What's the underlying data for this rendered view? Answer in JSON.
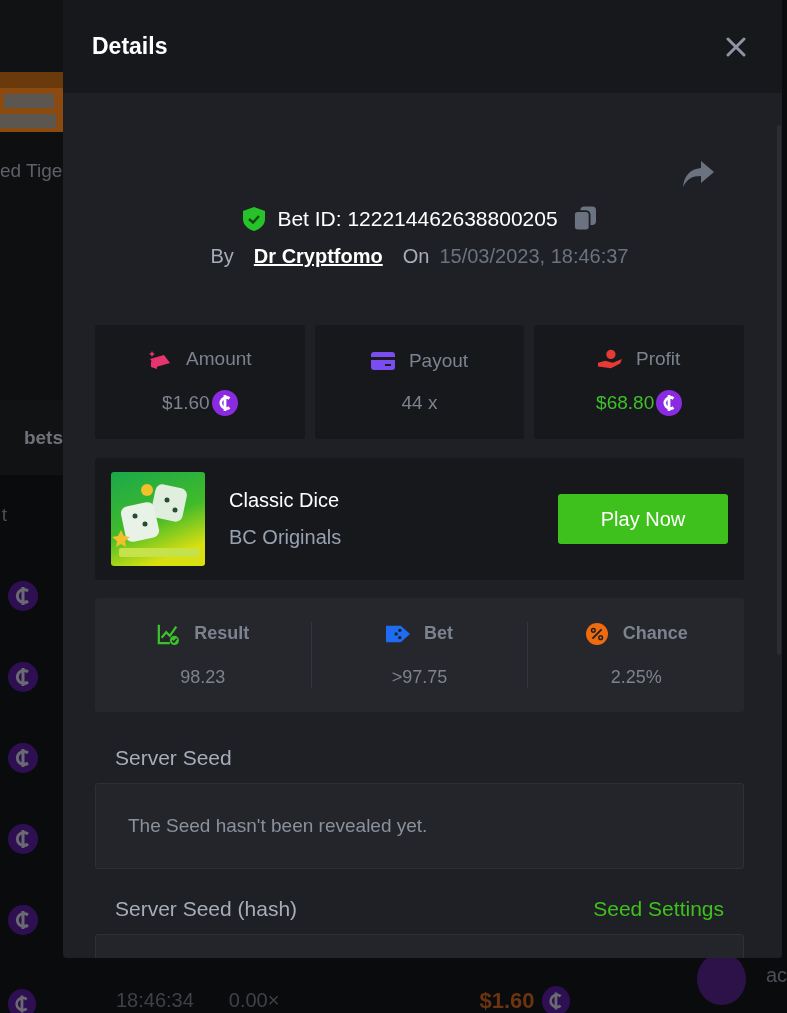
{
  "background": {
    "side_text": "ed Tige",
    "section_title": "bets",
    "column_label": "t",
    "bottom_row": {
      "time": "18:46:34",
      "payout": "0.00×",
      "amount": "$1.60",
      "user": "ac"
    }
  },
  "modal": {
    "title": "Details",
    "bet": {
      "id_label": "Bet ID: 122214462638800205",
      "by_label": "By",
      "user": "Dr Cryptfomo",
      "on_label": "On",
      "datetime": "15/03/2023, 18:46:37"
    },
    "stats": [
      {
        "kind": "amount",
        "label": "Amount",
        "value": "$1.60",
        "coin": true
      },
      {
        "kind": "payout",
        "label": "Payout",
        "value": "44 x",
        "coin": false
      },
      {
        "kind": "profit",
        "label": "Profit",
        "value": "$68.80",
        "coin": true
      }
    ],
    "game": {
      "name": "Classic Dice",
      "provider": "BC Originals",
      "button": "Play Now"
    },
    "results": [
      {
        "kind": "result",
        "label": "Result",
        "value": "98.23"
      },
      {
        "kind": "bet",
        "label": "Bet",
        "value": ">97.75"
      },
      {
        "kind": "chance",
        "label": "Chance",
        "value": "2.25%"
      }
    ],
    "server_seed": {
      "label": "Server Seed",
      "text": "The Seed hasn't been revealed yet."
    },
    "seed_hash": {
      "label": "Server Seed (hash)",
      "link": "Seed Settings"
    }
  }
}
